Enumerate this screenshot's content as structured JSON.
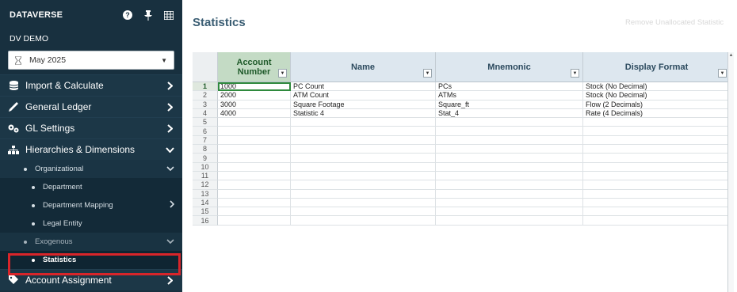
{
  "sidebar": {
    "brand": "DATAVERSE",
    "icons": [
      "help-icon",
      "pin-icon",
      "grid-icon"
    ],
    "org_name": "DV DEMO",
    "period": "May 2025",
    "nav": [
      {
        "label": "Import & Calculate",
        "icon": "database-icon",
        "chevron": "right"
      },
      {
        "label": "General Ledger",
        "icon": "pen-icon",
        "chevron": "right"
      },
      {
        "label": "GL Settings",
        "icon": "gears-icon",
        "chevron": "right"
      },
      {
        "label": "Hierarchies & Dimensions",
        "icon": "hierarchy-icon",
        "chevron": "down"
      }
    ],
    "organizational": "Organizational",
    "org_children": [
      "Department",
      "Department Mapping",
      "Legal Entity"
    ],
    "exogenous": "Exogenous",
    "selected": "Statistics",
    "account_assignment": "Account Assignment"
  },
  "main": {
    "title": "Statistics",
    "remove_button": "Remove Unallocated Statistic"
  },
  "grid": {
    "headers": {
      "account_number_line1": "Account",
      "account_number_line2": "Number",
      "name": "Name",
      "mnemonic": "Mnemonic",
      "display_format": "Display Format"
    },
    "rows": [
      {
        "n": "1",
        "acct": "1000",
        "name": "PC Count",
        "mn": "PCs",
        "df": "Stock (No Decimal)"
      },
      {
        "n": "2",
        "acct": "2000",
        "name": "ATM Count",
        "mn": "ATMs",
        "df": "Stock (No Decimal)"
      },
      {
        "n": "3",
        "acct": "3000",
        "name": "Square Footage",
        "mn": "Square_ft",
        "df": "Flow (2 Decimals)"
      },
      {
        "n": "4",
        "acct": "4000",
        "name": "Statistic 4",
        "mn": "Stat_4",
        "df": "Rate (4 Decimals)"
      },
      {
        "n": "5",
        "acct": "",
        "name": "",
        "mn": "",
        "df": ""
      },
      {
        "n": "6",
        "acct": "",
        "name": "",
        "mn": "",
        "df": ""
      },
      {
        "n": "7",
        "acct": "",
        "name": "",
        "mn": "",
        "df": ""
      },
      {
        "n": "8",
        "acct": "",
        "name": "",
        "mn": "",
        "df": ""
      },
      {
        "n": "9",
        "acct": "",
        "name": "",
        "mn": "",
        "df": ""
      },
      {
        "n": "10",
        "acct": "",
        "name": "",
        "mn": "",
        "df": ""
      },
      {
        "n": "11",
        "acct": "",
        "name": "",
        "mn": "",
        "df": ""
      },
      {
        "n": "12",
        "acct": "",
        "name": "",
        "mn": "",
        "df": ""
      },
      {
        "n": "13",
        "acct": "",
        "name": "",
        "mn": "",
        "df": ""
      },
      {
        "n": "14",
        "acct": "",
        "name": "",
        "mn": "",
        "df": ""
      },
      {
        "n": "15",
        "acct": "",
        "name": "",
        "mn": "",
        "df": ""
      },
      {
        "n": "16",
        "acct": "",
        "name": "",
        "mn": "",
        "df": ""
      }
    ]
  },
  "colors": {
    "sidebar_bg": "#18303f",
    "title": "#3a5d73",
    "highlight": "#d8252a",
    "account_header": "#c4dbc5",
    "header": "#dde7ef"
  }
}
